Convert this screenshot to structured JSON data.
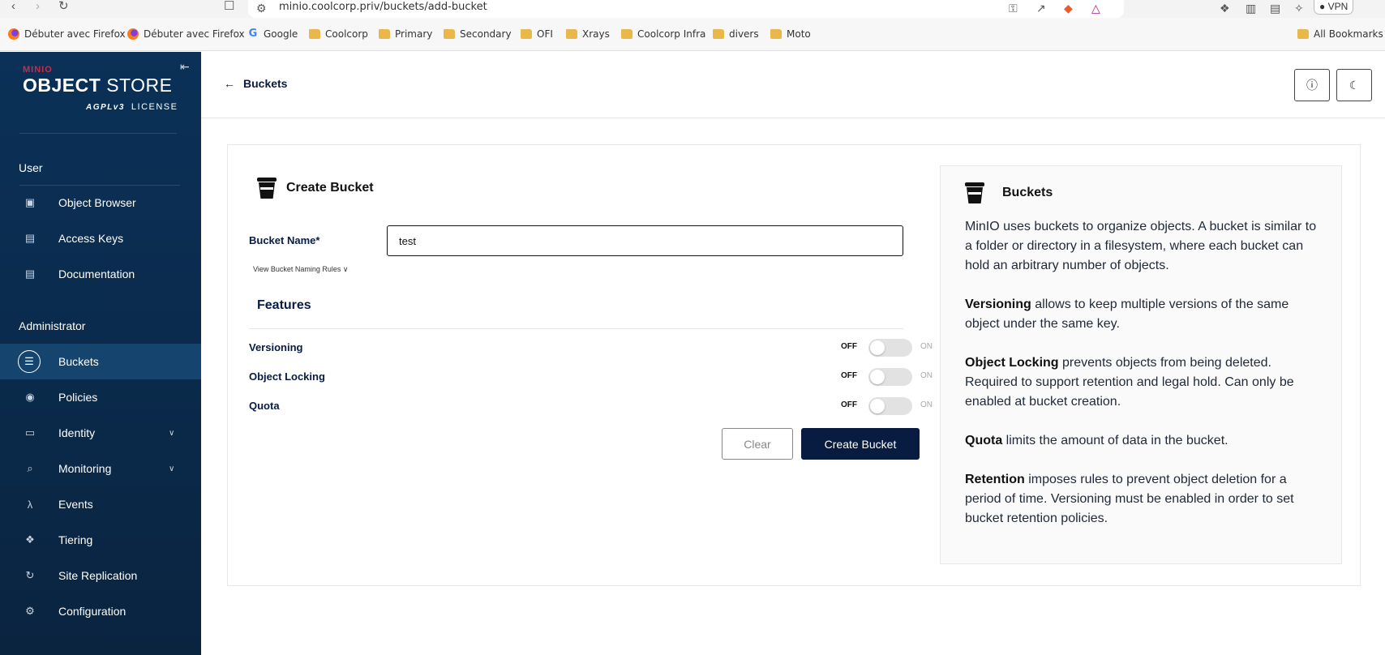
{
  "browser": {
    "url": "minio.coolcorp.priv/buckets/add-bucket",
    "vpn_label": "VPN",
    "bookmarks": [
      {
        "label": "Débuter avec Firefox",
        "icon": "firefox-icon"
      },
      {
        "label": "Débuter avec Firefox",
        "icon": "firefox-icon"
      },
      {
        "label": "Google",
        "icon": "google-icon"
      },
      {
        "label": "Coolcorp",
        "icon": "folder-icon"
      },
      {
        "label": "Primary",
        "icon": "folder-icon"
      },
      {
        "label": "Secondary",
        "icon": "folder-icon"
      },
      {
        "label": "OFI",
        "icon": "folder-icon"
      },
      {
        "label": "Xrays",
        "icon": "folder-icon"
      },
      {
        "label": "Coolcorp Infra",
        "icon": "folder-icon"
      },
      {
        "label": "divers",
        "icon": "folder-icon"
      },
      {
        "label": "Moto",
        "icon": "folder-icon"
      }
    ],
    "all_bookmarks": "All Bookmarks"
  },
  "sidebar": {
    "logo_brand": "MINIO",
    "logo_object": "OBJECT",
    "logo_store": "STORE",
    "logo_license_badge": "AGPLv3",
    "logo_license": "LICENSE",
    "user_section": "User",
    "admin_section": "Administrator",
    "user_items": [
      {
        "label": "Object Browser",
        "icon": "object-browser-icon"
      },
      {
        "label": "Access Keys",
        "icon": "access-keys-icon"
      },
      {
        "label": "Documentation",
        "icon": "documentation-icon"
      }
    ],
    "admin_items": [
      {
        "label": "Buckets",
        "icon": "bucket-icon",
        "active": true
      },
      {
        "label": "Policies",
        "icon": "policies-icon"
      },
      {
        "label": "Identity",
        "icon": "identity-icon",
        "expandable": true
      },
      {
        "label": "Monitoring",
        "icon": "monitoring-icon",
        "expandable": true
      },
      {
        "label": "Events",
        "icon": "lambda-icon"
      },
      {
        "label": "Tiering",
        "icon": "tiering-icon"
      },
      {
        "label": "Site Replication",
        "icon": "replication-icon"
      },
      {
        "label": "Configuration",
        "icon": "gear-icon"
      }
    ]
  },
  "header": {
    "back_label": "Buckets"
  },
  "form": {
    "title": "Create Bucket",
    "bucket_name_label": "Bucket Name*",
    "bucket_name_value": "test",
    "naming_rules_link": "View Bucket Naming Rules",
    "features_title": "Features",
    "features": [
      {
        "label": "Versioning",
        "off": "OFF",
        "on": "ON",
        "enabled": false
      },
      {
        "label": "Object Locking",
        "off": "OFF",
        "on": "ON",
        "enabled": false
      },
      {
        "label": "Quota",
        "off": "OFF",
        "on": "ON",
        "enabled": false
      }
    ],
    "clear_label": "Clear",
    "create_label": "Create Bucket"
  },
  "help": {
    "title": "Buckets",
    "intro": "MinIO uses buckets to organize objects. A bucket is similar to a folder or directory in a filesystem, where each bucket can hold an arbitrary number of objects.",
    "versioning_term": "Versioning",
    "versioning_text": " allows to keep multiple versions of the same object under the same key.",
    "locking_term": "Object Locking",
    "locking_text": " prevents objects from being deleted. Required to support retention and legal hold. Can only be enabled at bucket creation.",
    "quota_term": "Quota",
    "quota_text": " limits the amount of data in the bucket.",
    "retention_term": "Retention",
    "retention_text": " imposes rules to prevent object deletion for a period of time. Versioning must be enabled in order to set bucket retention policies."
  },
  "colors": {
    "sidebar_top": "#0b3158",
    "sidebar_bottom": "#0a2440",
    "primary": "#081c42",
    "active_item": "#15456f"
  }
}
